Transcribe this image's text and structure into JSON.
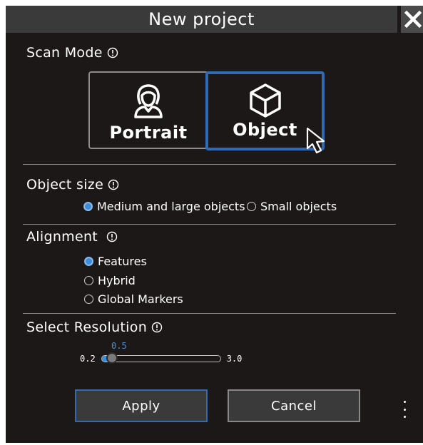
{
  "dialog": {
    "title": "New project",
    "close_icon": "close-icon"
  },
  "scan_mode": {
    "label": "Scan Mode",
    "info_icon": "info-icon",
    "options": [
      {
        "label": "Portrait",
        "icon": "person-icon",
        "selected": false
      },
      {
        "label": "Object",
        "icon": "cube-icon",
        "selected": true
      }
    ]
  },
  "object_size": {
    "label": "Object size",
    "info_icon": "info-icon",
    "options": [
      {
        "label": "Medium and large objects",
        "selected": true
      },
      {
        "label": "Small objects",
        "selected": false
      }
    ]
  },
  "alignment": {
    "label": "Alignment",
    "info_icon": "info-icon",
    "options": [
      {
        "label": "Features",
        "selected": true
      },
      {
        "label": "Hybrid",
        "selected": false
      },
      {
        "label": "Global Markers",
        "selected": false
      }
    ]
  },
  "resolution": {
    "label": "Select Resolution",
    "info_icon": "info-icon",
    "min": "0.2",
    "max": "3.0",
    "value": "0.5"
  },
  "actions": {
    "apply_label": "Apply",
    "cancel_label": "Cancel",
    "more_icon": "more-vertical-icon"
  },
  "colors": {
    "accent": "#2f6bb5",
    "background": "#1c1817",
    "titlebar": "#3a3a3a"
  }
}
